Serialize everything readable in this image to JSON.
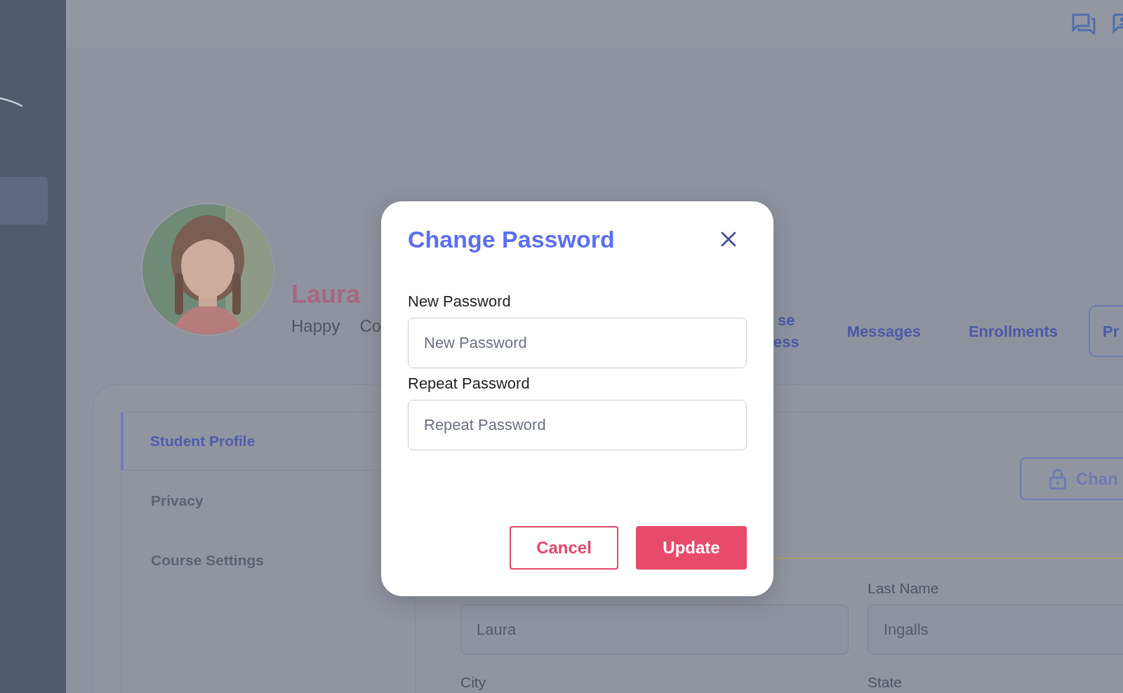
{
  "sidebar": {
    "items": [
      {
        "selected": true
      }
    ]
  },
  "profile": {
    "name": "Laura",
    "details": [
      "Happy",
      "Co"
    ],
    "avatar": {
      "kind": "picture"
    }
  },
  "tabs": [
    {
      "label": "se\ness",
      "selected": false
    },
    {
      "label": "Messages",
      "selected": false
    },
    {
      "label": "Enrollments",
      "selected": false
    },
    {
      "label": "Pr",
      "selected": true
    }
  ],
  "settings_nav": [
    {
      "label": "Student Profile",
      "selected": true
    },
    {
      "label": "Privacy",
      "selected": false
    },
    {
      "label": "Course Settings",
      "selected": false
    }
  ],
  "change_button": {
    "label": "Chan"
  },
  "form": {
    "fields": [
      {
        "value": "Laura"
      },
      {
        "label": "Last Name",
        "value": "Ingalls"
      }
    ],
    "labels_below": [
      "City",
      "State"
    ]
  },
  "modal": {
    "title": "Change Password",
    "fields": [
      {
        "label": "New Password",
        "placeholder": "New Password"
      },
      {
        "label": "Repeat Password",
        "placeholder": "Repeat Password"
      }
    ],
    "buttons": [
      {
        "label": "Cancel",
        "kind": "secondary"
      },
      {
        "label": "Update",
        "kind": "primary"
      }
    ]
  }
}
